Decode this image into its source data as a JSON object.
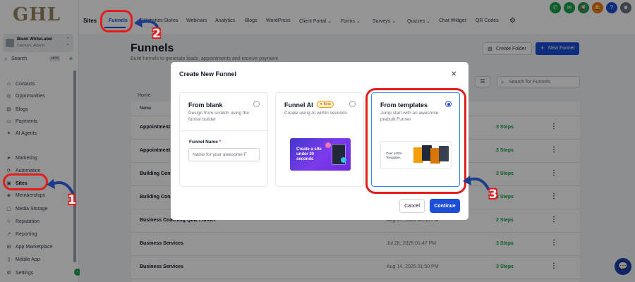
{
  "app": {
    "logo_text": "GHL",
    "account_name": "Blank WhiteLabel",
    "account_location": "Canmore, Alberta",
    "search_label": "Search",
    "search_shortcut": "ctrl K"
  },
  "sidebar": {
    "items": [
      {
        "label": "Contacts",
        "icon": "user-icon"
      },
      {
        "label": "Opportunities",
        "icon": "target-icon"
      },
      {
        "label": "Blogs",
        "icon": "blog-icon"
      },
      {
        "label": "Payments",
        "icon": "card-icon"
      },
      {
        "label": "AI Agents",
        "icon": "sparkle-icon"
      },
      {
        "label": "Marketing",
        "icon": "send-icon"
      },
      {
        "label": "Automation",
        "icon": "automation-icon"
      },
      {
        "label": "Sites",
        "icon": "sites-icon"
      },
      {
        "label": "Memberships",
        "icon": "membership-icon"
      },
      {
        "label": "Media Storage",
        "icon": "folder-icon"
      },
      {
        "label": "Reputation",
        "icon": "star-icon"
      },
      {
        "label": "Reporting",
        "icon": "chart-icon"
      },
      {
        "label": "App Marketplace",
        "icon": "grid-icon"
      },
      {
        "label": "Mobile App",
        "icon": "phone-icon"
      },
      {
        "label": "Settings",
        "icon": "gear-icon"
      }
    ]
  },
  "topnav": {
    "section": "Sites",
    "tabs": [
      "Funnels",
      "Websites",
      "Stores",
      "Webinars",
      "Analytics",
      "Blogs",
      "WordPress",
      "Client Portal",
      "Forms",
      "Surveys",
      "Quizzes",
      "Chat Widget",
      "QR Codes"
    ]
  },
  "page": {
    "title": "Funnels",
    "subtitle": "Build funnels to generate leads, appointments and receive payment",
    "create_folder": "Create Folder",
    "new_funnel": "New Funnel",
    "search_placeholder": "Search for Funnels",
    "breadcrumb": "Home",
    "column_name": "Name"
  },
  "table": {
    "rows": [
      {
        "name": "Appointment",
        "date": "",
        "steps": "3 Steps"
      },
      {
        "name": "Appointment",
        "date": "",
        "steps": "3 Steps"
      },
      {
        "name": "Building Cons",
        "date": "",
        "steps": "3 Steps"
      },
      {
        "name": "Building Cons",
        "date": "",
        "steps": "3 Steps"
      },
      {
        "name": "Business Coaching Quiz Funnel",
        "date": "Aug 07, 2025 05:59 PM",
        "steps": "2 Steps"
      },
      {
        "name": "Business Services",
        "date": "Jul 28, 2025 01:47 PM",
        "steps": "3 Steps"
      },
      {
        "name": "Business Services",
        "date": "Aug 14, 2025 01:50 PM",
        "steps": "3 Steps"
      }
    ]
  },
  "modal": {
    "title": "Create New Funnel",
    "cards": [
      {
        "title": "From blank",
        "desc": "Design from scratch using the funnel builder",
        "selected": false
      },
      {
        "title": "Funnel AI",
        "badge": "Beta",
        "desc": "Create using AI within seconds",
        "image_text": "Create a site under 30 seconds",
        "selected": false
      },
      {
        "title": "From templates",
        "desc": "Jump start with an awesome prebuilt Funnel",
        "image_text": "Over 1000+ Templates",
        "selected": true
      }
    ],
    "funnel_name_label": "Funnel Name",
    "required_mark": "*",
    "funnel_name_placeholder": "Name for your awesome F",
    "cancel": "Cancel",
    "continue": "Continue"
  },
  "annotations": {
    "numbers": [
      "1",
      "2",
      "3"
    ],
    "color": "#e11d1d"
  },
  "colors": {
    "primary": "#1d4ed8",
    "success": "#16a34a",
    "annotation": "#e11d1d"
  }
}
